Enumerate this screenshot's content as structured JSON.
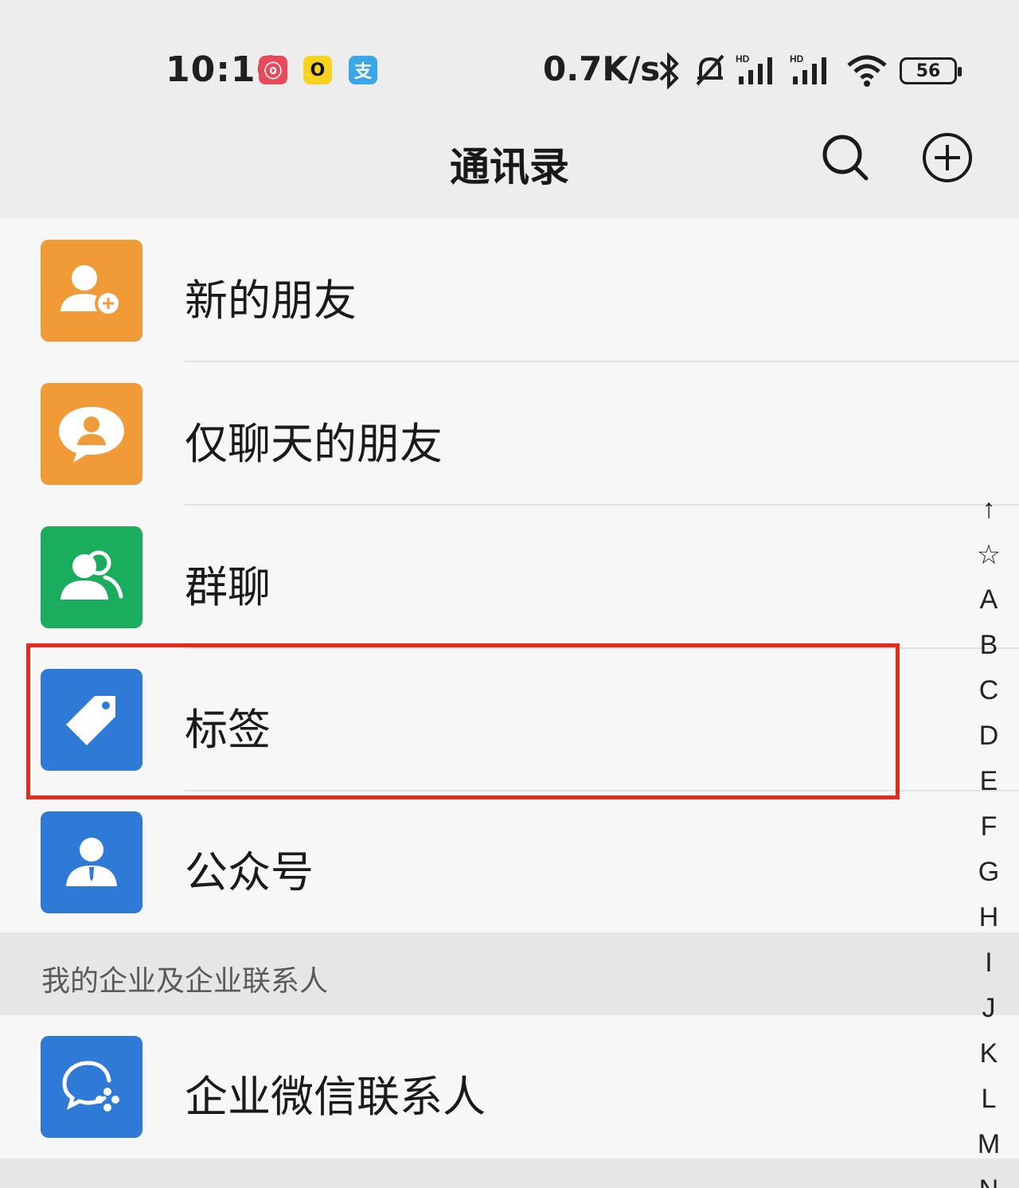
{
  "status_bar": {
    "time": "10:16",
    "apps": [
      {
        "name": "netease-music",
        "glyph": "ⓞ"
      },
      {
        "name": "ring-app",
        "glyph": "O"
      },
      {
        "name": "alipay",
        "glyph": "支"
      }
    ],
    "net_speed": "0.7K/s",
    "battery": "56"
  },
  "header": {
    "title": "通讯录"
  },
  "list": {
    "items": [
      {
        "label": "新的朋友",
        "icon": "add-friend-icon",
        "color": "#f19a38"
      },
      {
        "label": "仅聊天的朋友",
        "icon": "chat-only-friend-icon",
        "color": "#f19a38"
      },
      {
        "label": "群聊",
        "icon": "group-chat-icon",
        "color": "#1aad5e"
      },
      {
        "label": "标签",
        "icon": "tag-icon",
        "color": "#2e7ad6"
      },
      {
        "label": "公众号",
        "icon": "official-account-icon",
        "color": "#2e7ad6"
      }
    ]
  },
  "section": {
    "title": "我的企业及企业联系人"
  },
  "work": {
    "label": "企业微信联系人",
    "icon": "wecom-icon",
    "color": "#2e7ad6"
  },
  "index": {
    "letters": [
      "↑",
      "☆",
      "A",
      "B",
      "C",
      "D",
      "E",
      "F",
      "G",
      "H",
      "I",
      "J",
      "K",
      "L",
      "M",
      "N"
    ]
  },
  "highlight_color": "#e8291d"
}
